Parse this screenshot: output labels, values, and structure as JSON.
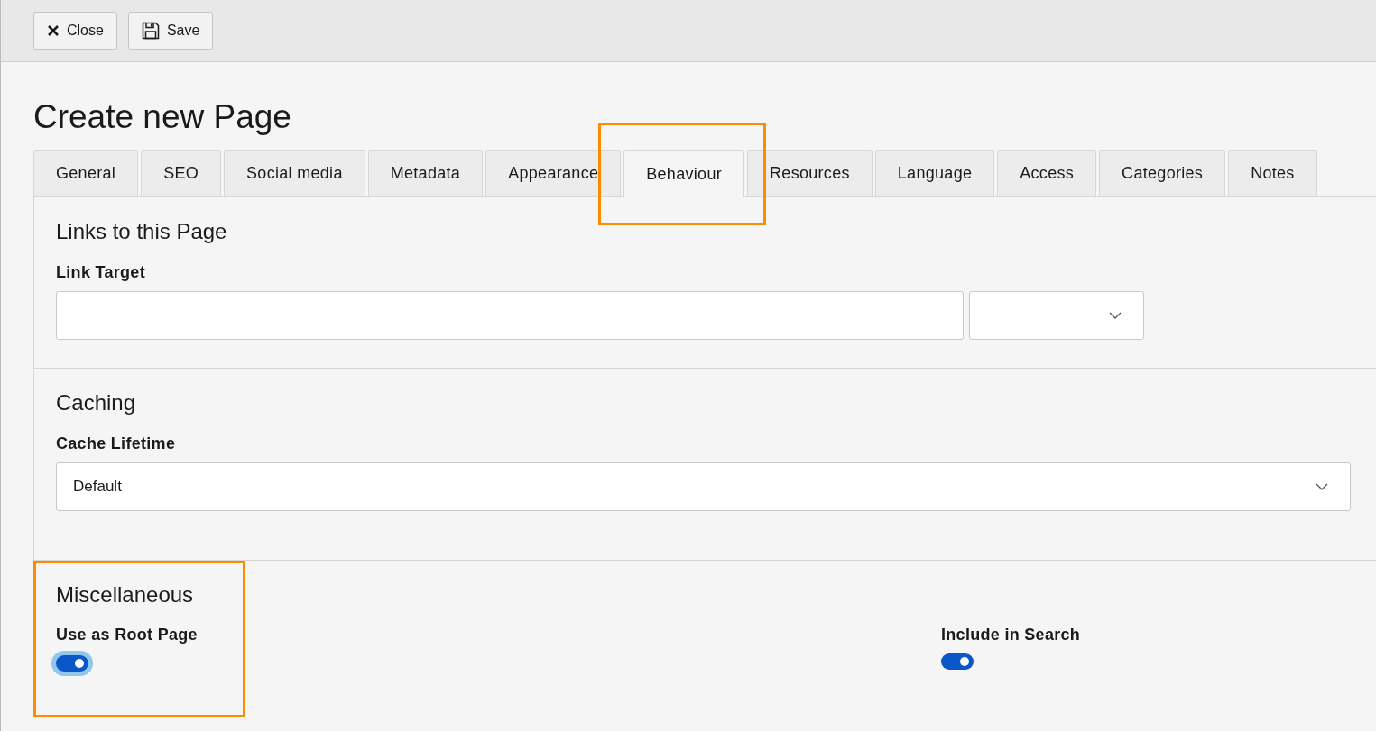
{
  "toolbar": {
    "buttons": [
      {
        "kind": "close",
        "label": "Close"
      },
      {
        "kind": "save",
        "label": "Save"
      }
    ]
  },
  "title": "Create new Page",
  "tabs": [
    {
      "label": "General",
      "selected": false,
      "highlighted": false
    },
    {
      "label": "SEO",
      "selected": false,
      "highlighted": false
    },
    {
      "label": "Social media",
      "selected": false,
      "highlighted": false
    },
    {
      "label": "Metadata",
      "selected": false,
      "highlighted": false
    },
    {
      "label": "Appearance",
      "selected": false,
      "highlighted": false
    },
    {
      "label": "Behaviour",
      "selected": true,
      "highlighted": true
    },
    {
      "label": "Resources",
      "selected": false,
      "highlighted": false
    },
    {
      "label": "Language",
      "selected": false,
      "highlighted": false
    },
    {
      "label": "Access",
      "selected": false,
      "highlighted": false
    },
    {
      "label": "Categories",
      "selected": false,
      "highlighted": false
    },
    {
      "label": "Notes",
      "selected": false,
      "highlighted": false
    }
  ],
  "sections": [
    {
      "heading": "Links to this Page",
      "highlighted": false,
      "fields": [
        {
          "kind": "input_with_select",
          "label": "Link Target"
        }
      ]
    },
    {
      "heading": "Caching",
      "highlighted": false,
      "fields": [
        {
          "kind": "select",
          "label": "Cache Lifetime",
          "value": "Default"
        }
      ]
    },
    {
      "heading": "Miscellaneous",
      "highlighted": true,
      "fields": [
        {
          "kind": "toggle",
          "label": "Use as Root Page",
          "on": true,
          "focused": true
        },
        {
          "kind": "toggle",
          "label": "Include in Search",
          "on": true,
          "focused": false
        }
      ]
    }
  ]
}
